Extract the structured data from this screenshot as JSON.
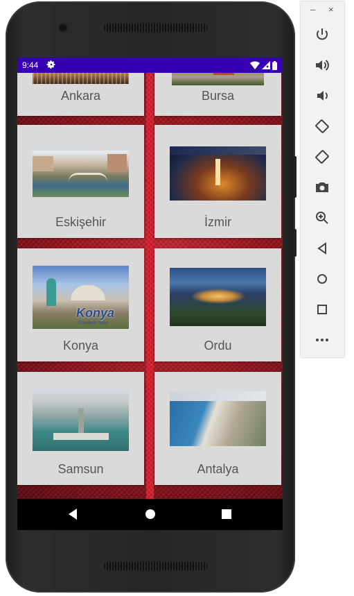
{
  "status_bar": {
    "time": "9:44"
  },
  "cities": [
    {
      "name": "Ankara"
    },
    {
      "name": "Bursa"
    },
    {
      "name": "Eskişehir"
    },
    {
      "name": "İzmir"
    },
    {
      "name": "Konya"
    },
    {
      "name": "Ordu"
    },
    {
      "name": "Samsun"
    },
    {
      "name": "Antalya"
    }
  ],
  "konya_image_text": {
    "logo": "Konya",
    "tagline": "Gönüllerin Şehri"
  },
  "emulator_toolbar": {
    "window_buttons": [
      "–",
      "×"
    ],
    "tools": [
      "power-icon",
      "volume-up-icon",
      "volume-down-icon",
      "rotate-left-icon",
      "rotate-right-icon",
      "camera-icon",
      "zoom-icon",
      "back-icon",
      "home-icon",
      "overview-icon",
      "more-icon"
    ]
  },
  "colors": {
    "status_bar": "#3700b3",
    "card": "#dadada",
    "label": "#555555",
    "background_red": "#9a1620"
  }
}
